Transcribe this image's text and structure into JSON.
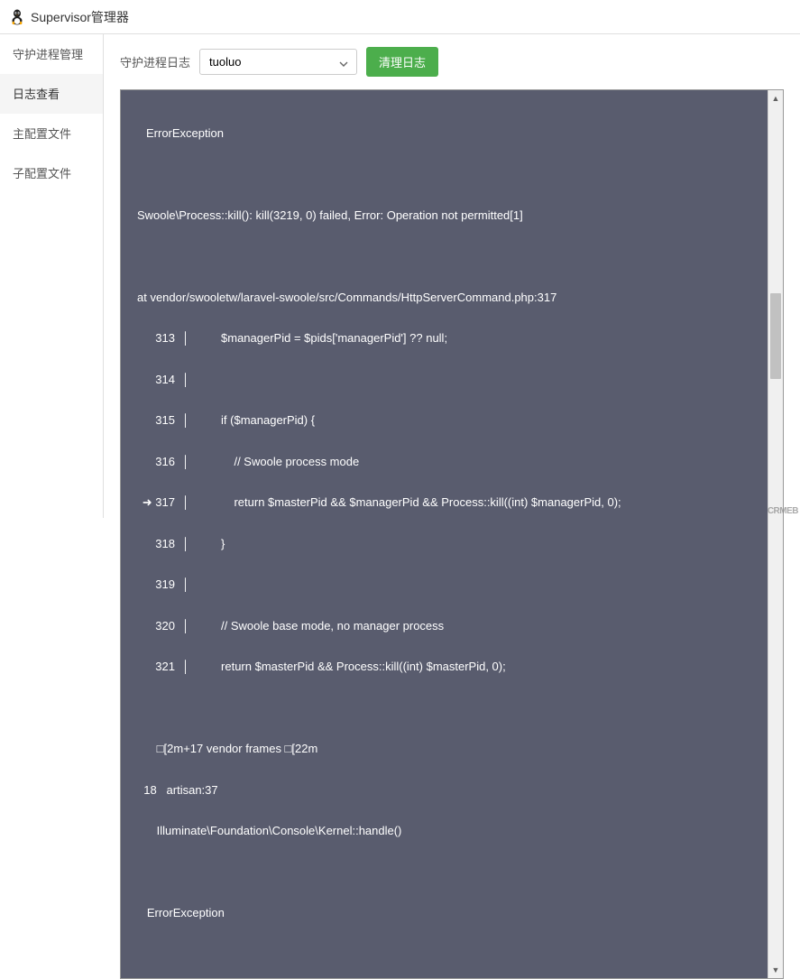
{
  "header": {
    "title": "Supervisor管理器"
  },
  "sidebar": {
    "items": [
      {
        "label": "守护进程管理"
      },
      {
        "label": "日志查看"
      },
      {
        "label": "主配置文件"
      },
      {
        "label": "子配置文件"
      }
    ],
    "active_index": 1
  },
  "toolbar": {
    "label": "守护进程日志",
    "select_value": "tuoluo",
    "clear_label": "清理日志"
  },
  "log": {
    "exception_title": "ErrorException",
    "message": "Swoole\\Process::kill(): kill(3219, 0) failed, Error: Operation not permitted[1]",
    "at_line": "at vendor/swooletw/laravel-swoole/src/Commands/HttpServerCommand.php:317",
    "code_lines": [
      {
        "num": "313",
        "arrow": "",
        "code": "        $managerPid = $pids['managerPid'] ?? null;"
      },
      {
        "num": "314",
        "arrow": "",
        "code": ""
      },
      {
        "num": "315",
        "arrow": "",
        "code": "        if ($managerPid) {"
      },
      {
        "num": "316",
        "arrow": "",
        "code": "            // Swoole process mode"
      },
      {
        "num": "317",
        "arrow": "➜ ",
        "code": "            return $masterPid && $managerPid && Process::kill((int) $managerPid, 0);"
      },
      {
        "num": "318",
        "arrow": "",
        "code": "        }"
      },
      {
        "num": "319",
        "arrow": "",
        "code": ""
      },
      {
        "num": "320",
        "arrow": "",
        "code": "        // Swoole base mode, no manager process"
      },
      {
        "num": "321",
        "arrow": "",
        "code": "        return $masterPid && Process::kill((int) $masterPid, 0);"
      }
    ],
    "frames_line": "      □[2m+17 vendor frames □[22m",
    "stack_line": "  18   artisan:37",
    "handle_line": "      Illuminate\\Foundation\\Console\\Kernel::handle()",
    "exception_again": "   ErrorException"
  },
  "watermark": "CRMEB",
  "icons": {
    "chevron_down": "chevron-down-icon",
    "scroll_up": "scroll-up-icon",
    "scroll_down": "scroll-down-icon",
    "tux": "tux-icon"
  }
}
